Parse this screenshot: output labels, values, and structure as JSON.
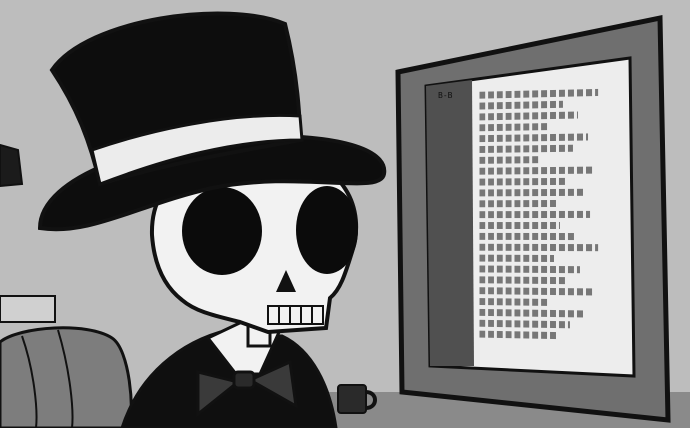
{
  "scene": {
    "subject": "skeleton-with-top-hat",
    "style": "monochrome-cartoon",
    "screen_header_text": "B-B"
  },
  "colors": {
    "background": "#bfbfbf",
    "ink": "#111111",
    "bone": "#f2f2f2",
    "monitor_frame": "#6f6f6f",
    "screen": "#ededed"
  },
  "icons": [
    "top-hat-icon",
    "bow-tie-icon",
    "mug-icon",
    "lamp-icon",
    "chair-icon",
    "monitor-icon"
  ]
}
